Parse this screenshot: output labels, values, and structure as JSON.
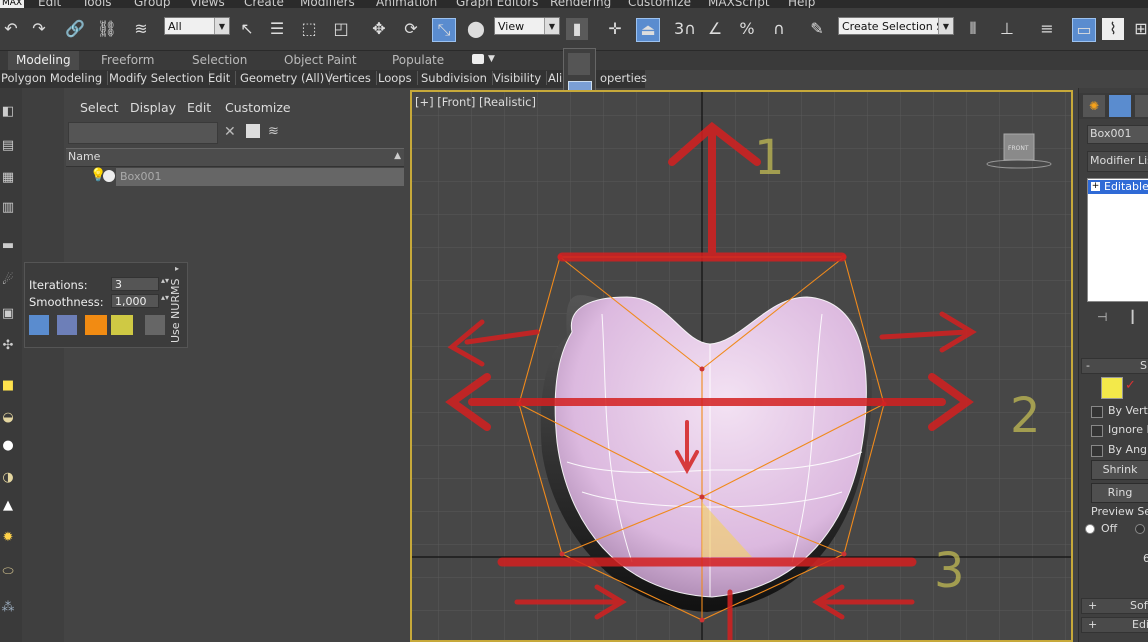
{
  "menu": {
    "items": [
      "Edit",
      "Tools",
      "Group",
      "Views",
      "Create",
      "Modifiers",
      "Animation",
      "Graph Editors",
      "Rendering",
      "Customize",
      "MAXScript",
      "Help"
    ],
    "app_badge": "MAX"
  },
  "toolbar": {
    "selection_filter": "All",
    "reference_coord": "View",
    "named_selection_placeholder": "Create Selection Se"
  },
  "ribbon": {
    "tabs": [
      "Modeling",
      "Freeform",
      "Selection",
      "Object Paint",
      "Populate"
    ],
    "sub_tabs": [
      "Polygon Modeling",
      "Modify Selection",
      "Edit",
      "Geometry (All)",
      "Vertices",
      "Loops",
      "Subdivision",
      "Visibility",
      "Ali",
      "operties"
    ]
  },
  "scene_explorer": {
    "menus": [
      "Select",
      "Display",
      "Edit",
      "Customize"
    ],
    "column_header": "Name",
    "objects": [
      {
        "name": "Box001"
      }
    ]
  },
  "caddy": {
    "iterations_label": "Iterations:",
    "iterations_value": "3",
    "smoothness_label": "Smoothness:",
    "smoothness_value": "1,000",
    "side_label": "Use NURMS"
  },
  "viewport": {
    "label": "[+] [Front] [Realistic]",
    "viewcube_label": "FRONT",
    "annotation_numbers": [
      "1",
      "2",
      "3"
    ]
  },
  "command_panel": {
    "object_name": "Box001",
    "modifier_list": "Modifier List",
    "stack_item": "Editable",
    "rollout_selection": "S",
    "by_vertex": "By Verte",
    "ignore_backfacing": "Ignore B",
    "by_angle": "By Angle",
    "shrink": "Shrink",
    "ring": "Ring",
    "preview_selection": "Preview Sele",
    "preview_off": "Off",
    "count_value": "6",
    "soft_selection": "Soft",
    "edit_rollout": "Edi"
  },
  "colors": {
    "accent": "#5a8ccf",
    "viewport_border": "#c7a93a",
    "annotation_red": "#d42020",
    "annotation_yellow": "#c9c255",
    "mesh_pink": "#e6c6e6",
    "cage_orange": "#f08a1c"
  }
}
